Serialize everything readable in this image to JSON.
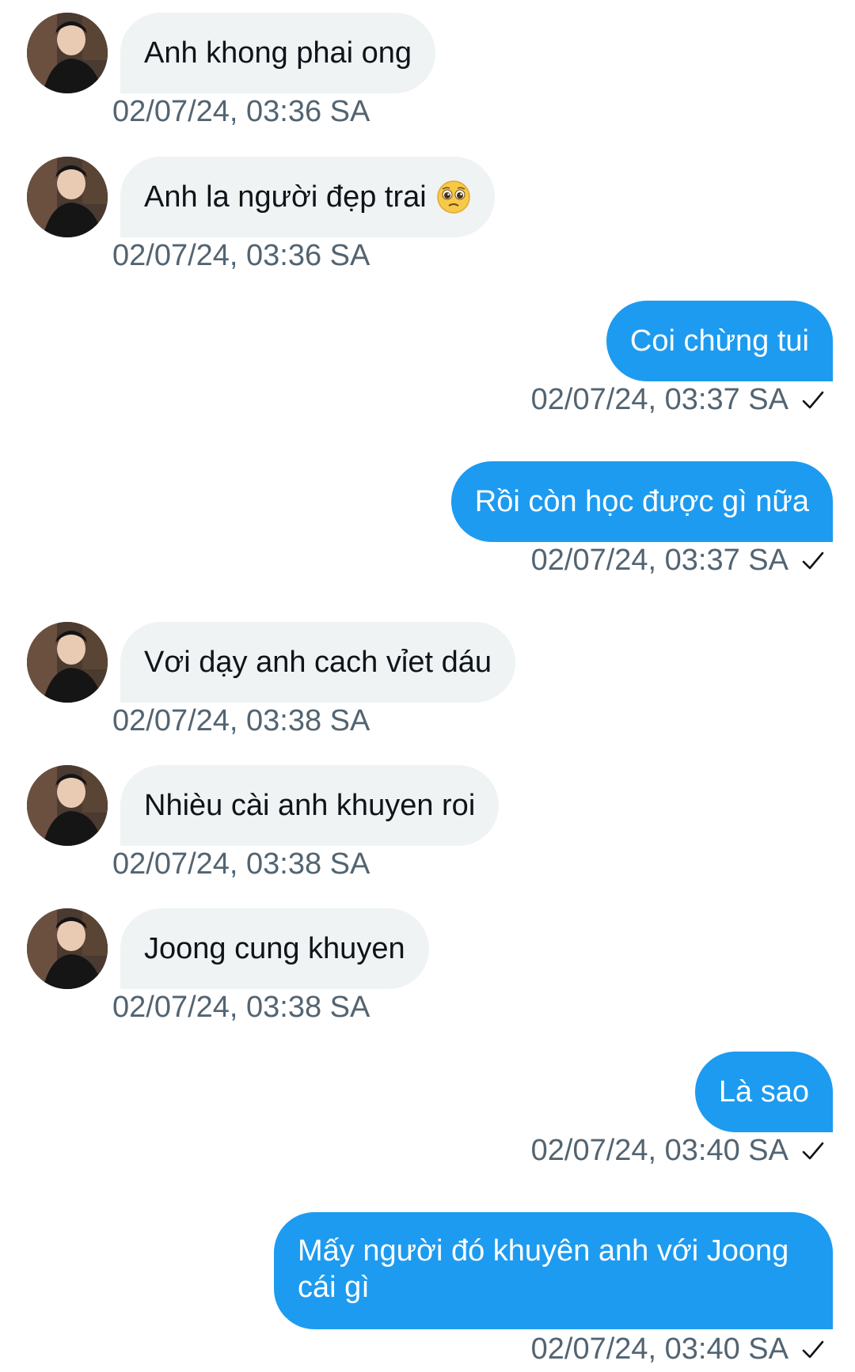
{
  "messages": [
    {
      "side": "in",
      "text": "Anh khong phai ong",
      "time": "02/07/24, 03:36 SA"
    },
    {
      "side": "in",
      "text": "Anh la người đẹp trai",
      "emoji": "pleading-face",
      "time": "02/07/24, 03:36 SA"
    },
    {
      "side": "out",
      "text": "Coi chừng tui",
      "time": "02/07/24, 03:37 SA"
    },
    {
      "side": "out",
      "text": "Rồi còn học được gì nữa",
      "time": "02/07/24, 03:37 SA"
    },
    {
      "side": "in",
      "text": "Vơi dạy anh cach vỉet dáu",
      "time": "02/07/24, 03:38 SA"
    },
    {
      "side": "in",
      "text": "Nhièu cài anh khuyen roi",
      "time": "02/07/24, 03:38 SA"
    },
    {
      "side": "in",
      "text": "Joong cung khuyen",
      "time": "02/07/24, 03:38 SA"
    },
    {
      "side": "out",
      "text": "Là sao",
      "time": "02/07/24, 03:40 SA"
    },
    {
      "side": "out",
      "text": "Mấy người đó khuyên anh với Joong cái gì",
      "time": "02/07/24, 03:40 SA"
    }
  ],
  "colors": {
    "incoming_bubble": "#eff3f4",
    "outgoing_bubble": "#1d9bf0",
    "timestamp": "#536471"
  },
  "icons": {
    "read_receipt": "check-icon",
    "avatar": "avatar"
  }
}
